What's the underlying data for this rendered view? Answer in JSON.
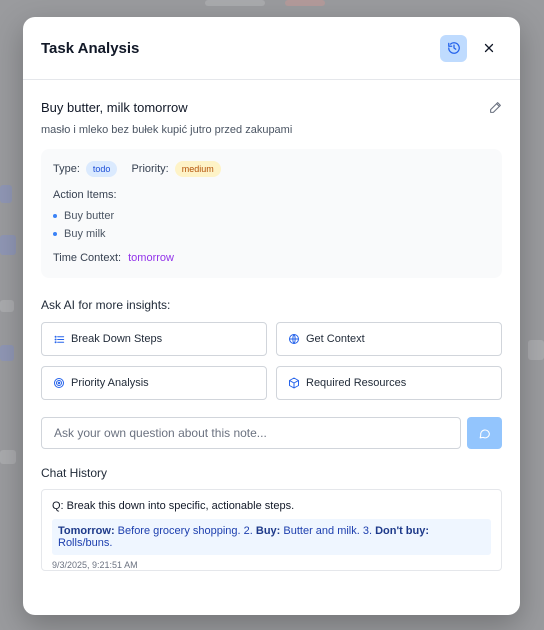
{
  "modal": {
    "title": "Task Analysis"
  },
  "note": {
    "title": "Buy butter, milk tomorrow",
    "original": "masło i mleko bez bułek kupić jutro przed zakupami",
    "type_label": "Type:",
    "type_value": "todo",
    "priority_label": "Priority:",
    "priority_value": "medium",
    "action_items_label": "Action Items:",
    "action_items": [
      "Buy butter",
      "Buy milk"
    ],
    "time_context_label": "Time Context:",
    "time_context_value": "tomorrow"
  },
  "ai": {
    "title": "Ask AI for more insights:",
    "buttons": [
      {
        "label": "Break Down Steps",
        "icon": "list-icon"
      },
      {
        "label": "Get Context",
        "icon": "globe-icon"
      },
      {
        "label": "Priority Analysis",
        "icon": "target-icon"
      },
      {
        "label": "Required Resources",
        "icon": "box-icon"
      }
    ],
    "input_placeholder": "Ask your own question about this note..."
  },
  "chat": {
    "title": "Chat History",
    "question": "Q: Break this down into specific, actionable steps.",
    "answer": {
      "label1": "Tomorrow:",
      "text1": " Before grocery shopping. 2. ",
      "label2": "Buy:",
      "text2": " Butter and milk. 3. ",
      "label3": "Don't buy:",
      "text3": " Rolls/buns."
    },
    "timestamp": "9/3/2025, 9:21:51 AM"
  },
  "colors": {
    "accent": "#3b82f6",
    "history_bg": "#bfdbfe",
    "send_bg": "#93c5fd",
    "time_context": "#9333ea"
  }
}
